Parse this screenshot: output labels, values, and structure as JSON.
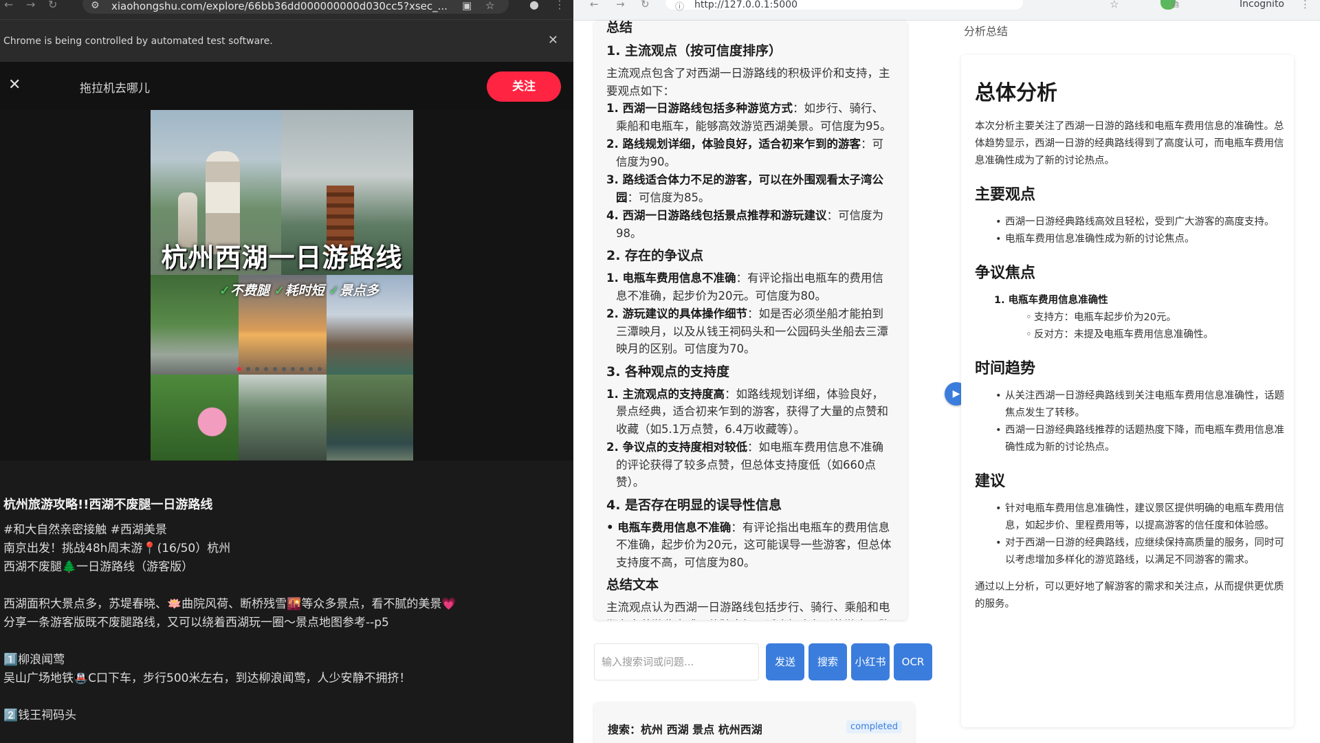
{
  "left_window": {
    "url": "xiaohongshu.com/explore/66bb36dd000000000d030cc5?xsec_...",
    "automation_notice": "Chrome is being controlled by automated test software.",
    "author_name": "拖拉机去哪儿",
    "follow_label": "关注",
    "collage": {
      "title": "杭州西湖一日游路线",
      "tag1": "不费腿",
      "tag2": "耗时短",
      "tag3": "景点多",
      "check": "✓"
    },
    "note": {
      "title": "杭州旅游攻略!!西湖不废腿一日游路线",
      "lines": [
        "#和大自然亲密接触 #西湖美景",
        "南京出发！挑战48h周末游📍(16/50）杭州",
        "西湖不废腿🌲一日游路线（游客版）",
        "",
        "西湖面积大景点多，苏堤春晓、🪷曲院风荷、断桥残雪🌇等众多景点，看不腻的美景💗",
        "分享一条游客版既不废腿路线，又可以绕着西湖玩一圈～景点地图参考--p5",
        "",
        "1️⃣柳浪闻莺",
        "吴山广场地铁🚇C口下车，步行500米左右，到达柳浪闻莺，人少安静不拥挤！",
        "",
        "2️⃣钱王祠码头"
      ]
    }
  },
  "right_window": {
    "url": "http://127.0.0.1:5000",
    "incognito_label": "Incognito",
    "result": {
      "top_heading": "总结",
      "h1": "1. 主流观点（按可信度排序）",
      "p1": "主流观点包含了对西湖一日游路线的积极评价和支持，主要观点如下：",
      "list1": [
        {
          "bold": "1. 西湖一日游路线包括多种游览方式",
          "rest": "：如步行、骑行、乘船和电瓶车，能够高效游览西湖美景。可信度为95。"
        },
        {
          "bold": "2. 路线规划详细，体验良好，适合初来乍到的游客",
          "rest": "：可信度为90。"
        },
        {
          "bold": "3. 路线适合体力不足的游客，可以在外围观看太子湾公园",
          "rest": "：可信度为85。"
        },
        {
          "bold": "4. 西湖一日游路线包括景点推荐和游玩建议",
          "rest": "：可信度为98。"
        }
      ],
      "h2": "2. 存在的争议点",
      "list2": [
        {
          "bold": "1. 电瓶车费用信息不准确",
          "rest": "：有评论指出电瓶车的费用信息不准确，起步价为20元。可信度为80。"
        },
        {
          "bold": "2. 游玩建议的具体操作细节",
          "rest": "：如是否必须坐船才能拍到三潭映月，以及从钱王祠码头和一公园码头坐船去三潭映月的区别。可信度为70。"
        }
      ],
      "h3": "3. 各种观点的支持度",
      "list3": [
        {
          "bold": "1. 主流观点的支持度高",
          "rest": "：如路线规划详细，体验良好，景点经典，适合初来乍到的游客，获得了大量的点赞和收藏（如5.1万点赞，6.4万收藏等）。"
        },
        {
          "bold": "2. 争议点的支持度相对较低",
          "rest": "：如电瓶车费用信息不准确的评论获得了较多点赞，但总体支持度低（如660点赞）。"
        }
      ],
      "h4": "4. 是否存在明显的误导性信息",
      "list4": [
        {
          "bold": "• 电瓶车费用信息不准确",
          "rest": "：有评论指出电瓶车的费用信息不准确，起步价为20元，这可能误导一些游客，但总体支持度不高，可信度为80。"
        }
      ],
      "h5": "总结文本",
      "p5": "主流观点认为西湖一日游路线包括步行、骑行、乘船和电瓶车多种游览方式，体验良好，适合初来乍到的游客，路"
    },
    "input": {
      "placeholder": "输入搜索词或问题...",
      "btn_send": "发送",
      "btn_search": "搜索",
      "btn_xhs": "小红书",
      "btn_ocr": "OCR"
    },
    "search_card": {
      "label": "搜索：杭州 西湖 景点 杭州西湖",
      "status": "completed"
    },
    "summary": {
      "label": "分析总结",
      "title": "总体分析",
      "intro": "本次分析主要关注了西湖一日游的路线和电瓶车费用信息的准确性。总体趋势显示，西湖一日游的经典路线得到了高度认可，而电瓶车费用信息准确性成为了新的讨论热点。",
      "h_main": "主要观点",
      "main_items": [
        "西湖一日游经典路线高效且轻松，受到广大游客的高度支持。",
        "电瓶车费用信息准确性成为新的讨论焦点。"
      ],
      "h_dispute": "争议焦点",
      "dispute_title": "1. 电瓶车费用信息准确性",
      "dispute_sub": [
        "支持方：电瓶车起步价为20元。",
        "反对方：未提及电瓶车费用信息准确性。"
      ],
      "h_trend": "时间趋势",
      "trend_items": [
        "从关注西湖一日游经典路线到关注电瓶车费用信息准确性，话题焦点发生了转移。",
        "西湖一日游经典路线推荐的话题热度下降，而电瓶车费用信息准确性成为新的讨论热点。"
      ],
      "h_suggest": "建议",
      "suggest_items": [
        "针对电瓶车费用信息准确性，建议景区提供明确的电瓶车费用信息，如起步价、里程费用等，以提高游客的信任度和体验感。",
        "对于西湖一日游的经典路线，应继续保持高质量的服务，同时可以考虑增加多样化的游览路线，以满足不同游客的需求。"
      ],
      "conclusion": "通过以上分析，可以更好地了解游客的需求和关注点，从而提供更优质的服务。"
    }
  }
}
